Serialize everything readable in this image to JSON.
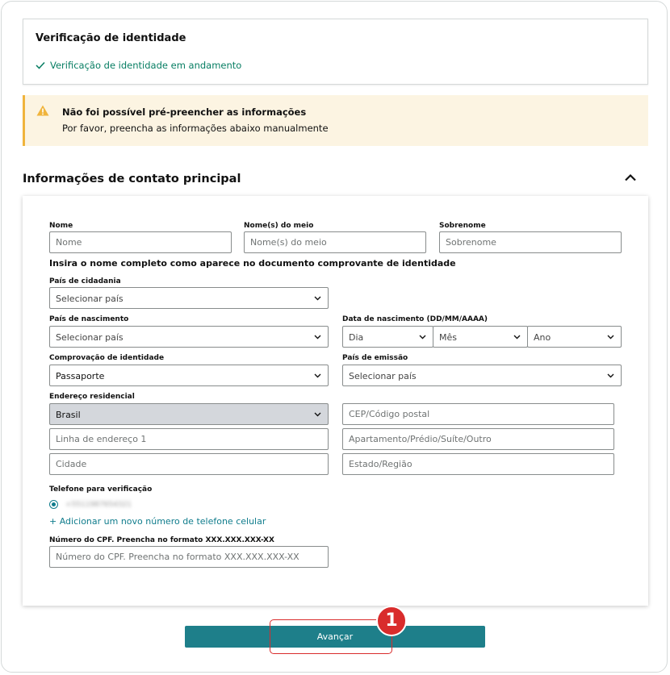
{
  "verification": {
    "title": "Verificação de identidade",
    "status": "Verificação de identidade em andamento"
  },
  "alert": {
    "title": "Não foi possível pré-preencher as informações",
    "message": "Por favor, preencha as informações abaixo manualmente"
  },
  "section": {
    "title": "Informações de contato principal"
  },
  "form": {
    "first_name": {
      "label": "Nome",
      "placeholder": "Nome"
    },
    "middle_name": {
      "label": "Nome(s) do meio",
      "placeholder": "Nome(s) do meio"
    },
    "last_name": {
      "label": "Sobrenome",
      "placeholder": "Sobrenome"
    },
    "name_hint": "Insira o nome completo como aparece no documento comprovante de identidade",
    "citizenship": {
      "label": "País de cidadania",
      "value": "Selecionar país"
    },
    "birth_country": {
      "label": "País de nascimento",
      "value": "Selecionar país"
    },
    "birth_date": {
      "label": "Data de nascimento (DD/MM/AAAA)",
      "day": "Dia",
      "month": "Mês",
      "year": "Ano"
    },
    "id_proof": {
      "label": "Comprovação de identidade",
      "value": "Passaporte"
    },
    "issuing_country": {
      "label": "País de emissão",
      "value": "Selecionar país"
    },
    "address": {
      "label": "Endereço residencial",
      "country": "Brasil",
      "postal_placeholder": "CEP/Código postal",
      "line1_placeholder": "Linha de endereço 1",
      "line2_placeholder": "Apartamento/Prédio/Suíte/Outro",
      "city_placeholder": "Cidade",
      "state_placeholder": "Estado/Região"
    },
    "phone": {
      "label": "Telefone para verificação",
      "number": "+5511987654321",
      "add_link": "+ Adicionar um novo número de telefone celular"
    },
    "cpf": {
      "label": "Número do CPF. Preencha no formato XXX.XXX.XXX-XX",
      "placeholder": "Número do CPF. Preencha no formato XXX.XXX.XXX-XX"
    }
  },
  "next_button": "Avançar",
  "step_badge": "1",
  "colors": {
    "accent": "#1e7f8a",
    "success": "#067d62",
    "warning": "#f0b43c",
    "highlight": "#d92c2c"
  }
}
